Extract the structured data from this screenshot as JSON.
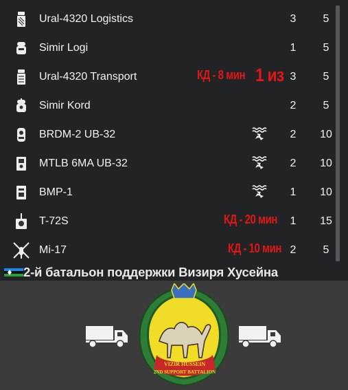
{
  "units": [
    {
      "name": "Ural-4320 Logistics",
      "icon": "supply-truck-icon",
      "count": "3",
      "cost": "5"
    },
    {
      "name": "Simir Logi",
      "icon": "light-vehicle-icon",
      "count": "1",
      "cost": "5"
    },
    {
      "name": "Ural-4320 Transport",
      "icon": "supply-truck-icon",
      "count": "3",
      "cost": "5",
      "note": "КД - 8 мин",
      "note_big": "1 из"
    },
    {
      "name": "Simir Kord",
      "icon": "armed-light-vehicle-icon",
      "count": "2",
      "cost": "5"
    },
    {
      "name": "BRDM-2 UB-32",
      "icon": "wheeled-apc-icon",
      "count": "2",
      "cost": "10",
      "trait": "amphibious-icon"
    },
    {
      "name": "MTLB 6MA UB-32",
      "icon": "tracked-apc-icon",
      "count": "2",
      "cost": "10",
      "trait": "amphibious-icon"
    },
    {
      "name": "BMP-1",
      "icon": "ifv-icon",
      "count": "1",
      "cost": "10",
      "trait": "amphibious-icon"
    },
    {
      "name": "T-72S",
      "icon": "tank-icon",
      "count": "1",
      "cost": "15",
      "note": "КД - 20 мин"
    },
    {
      "name": "Mi-17",
      "icon": "helicopter-icon",
      "count": "2",
      "cost": "5",
      "note": "КД - 10 мин"
    }
  ],
  "faction": {
    "title": "2-й батальон поддержки Визиря Хусейна",
    "flag_icon": "faction-flag-icon",
    "emblem_icon": "camel-crest-emblem",
    "emblem_text_top": "VIZIR HUSSEIN",
    "emblem_text_bottom": "2ND SUPPORT BATTALION",
    "side_icons": [
      "supply-truck-icon",
      "supply-truck-icon"
    ]
  },
  "colors": {
    "note": "#e21616",
    "panel": "#222324",
    "background": "#3b3b3b"
  }
}
